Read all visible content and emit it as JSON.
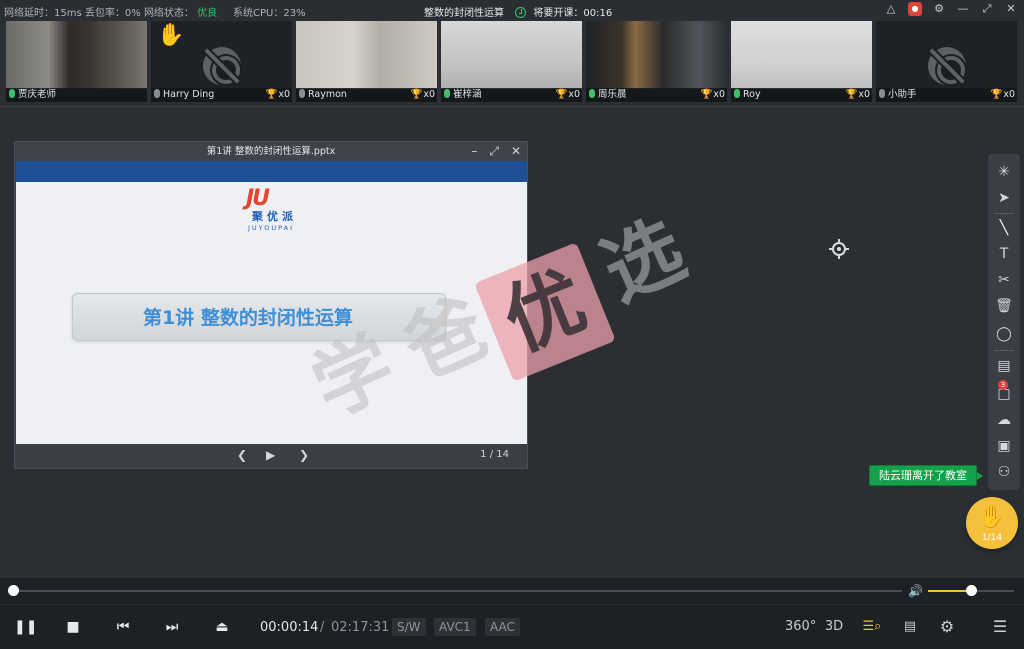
{
  "status_bar": {
    "latency_label": "网络延时：",
    "latency_value": "15ms",
    "loss_label": "丢包率：",
    "loss_value": "0%",
    "net_label": "网络状态：",
    "net_value": "优良",
    "cpu_label": "系统CPU：",
    "cpu_value": "23%",
    "lesson_title": "整数的封闭性运算",
    "countdown_label": "将要开课：",
    "countdown_value": "00:16"
  },
  "participants": [
    {
      "name": "贾庆老师",
      "mic": "on",
      "trophy": "",
      "camera": "on",
      "hand": false
    },
    {
      "name": "Harry Ding",
      "mic": "off",
      "trophy": "x0",
      "camera": "off",
      "hand": true
    },
    {
      "name": "Raymon",
      "mic": "off",
      "trophy": "x0",
      "camera": "on",
      "hand": false
    },
    {
      "name": "崔梓涵",
      "mic": "on",
      "trophy": "x0",
      "camera": "on",
      "hand": false
    },
    {
      "name": "周乐晨",
      "mic": "on",
      "trophy": "x0",
      "camera": "on",
      "hand": false
    },
    {
      "name": "Roy",
      "mic": "on",
      "trophy": "x0",
      "camera": "on",
      "hand": false
    },
    {
      "name": "小助手",
      "mic": "off",
      "trophy": "x0",
      "camera": "off",
      "hand": false
    }
  ],
  "slide_window": {
    "title": "第1讲 整数的封闭性运算.pptx",
    "logo_mark": "JU",
    "logo_cn": "聚优派",
    "logo_en": "JUYOUPAI",
    "headline": "第1讲  整数的封闭性运算",
    "page": "1 / 14"
  },
  "watermark": {
    "c1": "学",
    "c2": "爸",
    "c3": "优",
    "c4": "选"
  },
  "toast": "陆云珊离开了教室",
  "chat_badge": "3",
  "raise_hand": {
    "count": "1/14"
  },
  "player": {
    "current_time": "00:00:14",
    "separator": "/",
    "total_time": "02:17:31",
    "tag_sw": "S/W",
    "tag_video": "AVC1",
    "tag_audio": "AAC",
    "btn_360": "360°",
    "btn_3d": "3D",
    "progress": 0.001,
    "volume": 0.5
  },
  "colors": {
    "accent": "#f2c230",
    "good": "#3fbf6a",
    "toast": "#15a04a",
    "headline": "#3f8fd6"
  }
}
